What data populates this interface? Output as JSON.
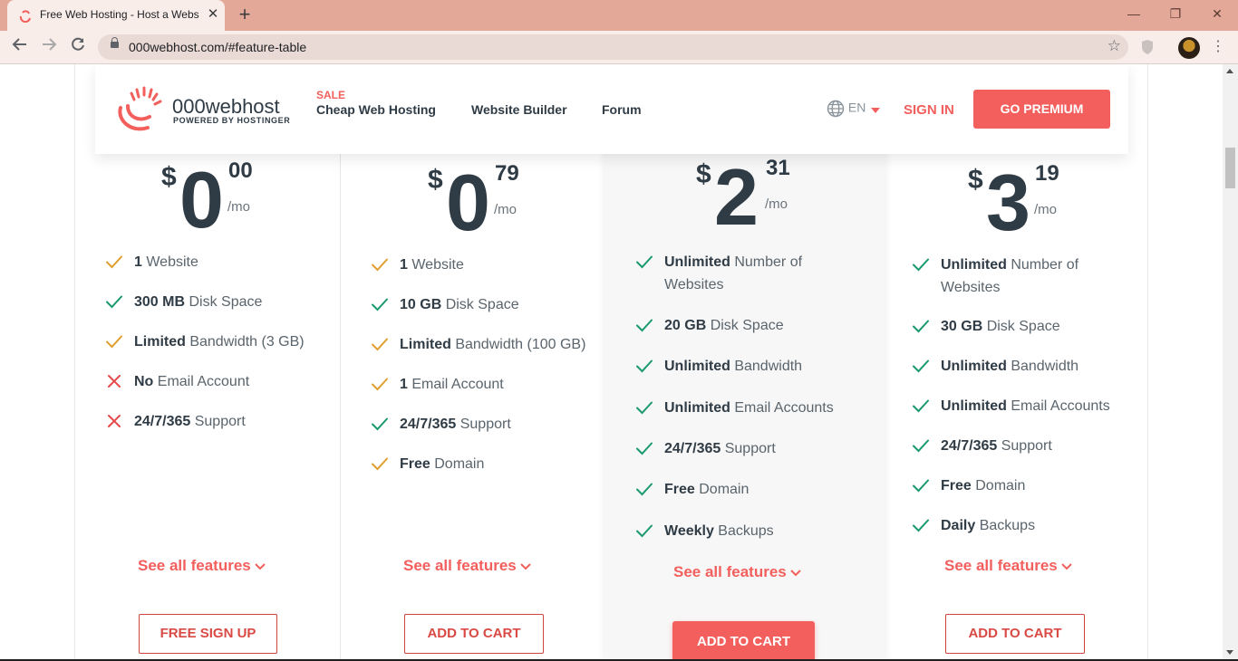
{
  "browser": {
    "tab_title": "Free Web Hosting - Host a Website for Free",
    "url": "000webhost.com/#feature-table",
    "new_tab": "+",
    "close_tab": "✕",
    "window": {
      "minimize": "—",
      "restore": "❐",
      "close": "✕"
    }
  },
  "header": {
    "logo_name": "000webhost",
    "logo_sub": "POWERED BY HOSTINGER",
    "sale_label": "SALE",
    "nav": [
      "Cheap Web Hosting",
      "Website Builder",
      "Forum"
    ],
    "language": "EN",
    "sign_in": "SIGN IN",
    "go_premium": "GO PREMIUM"
  },
  "plans": [
    {
      "currency": "$",
      "whole": "0",
      "cents": "00",
      "period": "/mo",
      "features": [
        {
          "strong": "1",
          "text": " Website",
          "mark": "check-orange"
        },
        {
          "strong": "300 MB",
          "text": " Disk Space",
          "mark": "check-green"
        },
        {
          "strong": "Limited",
          "text": " Bandwidth (3 GB)",
          "mark": "check-orange"
        },
        {
          "strong": "No",
          "text": " Email Account",
          "mark": "cross-red"
        },
        {
          "strong": "24/7/365",
          "text": " Support",
          "mark": "cross-red"
        }
      ],
      "see_all": "See all features",
      "cta": "FREE SIGN UP"
    },
    {
      "currency": "$",
      "whole": "0",
      "cents": "79",
      "period": "/mo",
      "features": [
        {
          "strong": "1",
          "text": " Website",
          "mark": "check-orange"
        },
        {
          "strong": "10 GB",
          "text": " Disk Space",
          "mark": "check-green"
        },
        {
          "strong": "Limited",
          "text": " Bandwidth (100 GB)",
          "mark": "check-orange"
        },
        {
          "strong": "1",
          "text": " Email Account",
          "mark": "check-orange"
        },
        {
          "strong": "24/7/365",
          "text": " Support",
          "mark": "check-green"
        },
        {
          "strong": "Free",
          "text": " Domain",
          "mark": "check-orange"
        }
      ],
      "see_all": "See all features",
      "cta": "ADD TO CART"
    },
    {
      "currency": "$",
      "whole": "2",
      "cents": "31",
      "period": "/mo",
      "features": [
        {
          "strong": "Unlimited",
          "text": " Number of Websites",
          "mark": "check-green"
        },
        {
          "strong": "20 GB",
          "text": " Disk Space",
          "mark": "check-green"
        },
        {
          "strong": "Unlimited",
          "text": " Bandwidth",
          "mark": "check-green"
        },
        {
          "strong": "Unlimited",
          "text": " Email Accounts",
          "mark": "check-green"
        },
        {
          "strong": "24/7/365",
          "text": " Support",
          "mark": "check-green"
        },
        {
          "strong": "Free",
          "text": " Domain",
          "mark": "check-green"
        },
        {
          "strong": "Weekly",
          "text": " Backups",
          "mark": "check-green"
        }
      ],
      "see_all": "See all features",
      "cta": "ADD TO CART"
    },
    {
      "currency": "$",
      "whole": "3",
      "cents": "19",
      "period": "/mo",
      "features": [
        {
          "strong": "Unlimited",
          "text": " Number of Websites",
          "mark": "check-green"
        },
        {
          "strong": "30 GB",
          "text": " Disk Space",
          "mark": "check-green"
        },
        {
          "strong": "Unlimited",
          "text": " Bandwidth",
          "mark": "check-green"
        },
        {
          "strong": "Unlimited",
          "text": " Email Accounts",
          "mark": "check-green"
        },
        {
          "strong": "24/7/365",
          "text": " Support",
          "mark": "check-green"
        },
        {
          "strong": "Free",
          "text": " Domain",
          "mark": "check-green"
        },
        {
          "strong": "Daily",
          "text": " Backups",
          "mark": "check-green"
        }
      ],
      "see_all": "See all features",
      "cta": "ADD TO CART"
    }
  ],
  "colors": {
    "accent": "#f25f5c",
    "check_green": "#1a9a6c",
    "check_orange": "#e0a030",
    "cross_red": "#e8474a",
    "text_dark": "#2f3b45",
    "tab_bar": "#e4a899"
  }
}
